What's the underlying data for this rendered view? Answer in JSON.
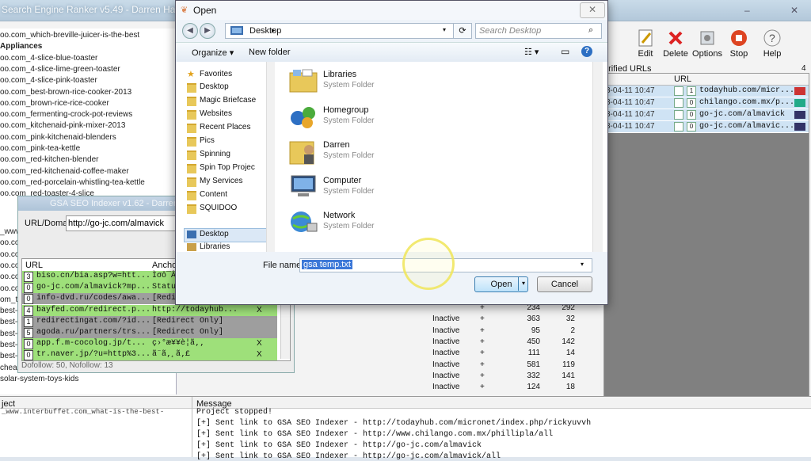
{
  "ser": {
    "title": "Search Engine Ranker v5.49 - Darren Haynes",
    "projects": [
      "oo.com_which-breville-juicer-is-the-best",
      "Appliances",
      "oo.com_4-slice-blue-toaster",
      "oo.com_4-slice-lime-green-toaster",
      "oo.com_4-slice-pink-toaster",
      "oo.com_best-brown-rice-cooker-2013",
      "oo.com_brown-rice-rice-cooker",
      "oo.com_fermenting-crock-pot-reviews",
      "oo.com_kitchenaid-pink-mixer-2013",
      "oo.com_pink-kitchenaid-blenders",
      "oo.com_pink-tea-kettle",
      "oo.com_red-kitchen-blender",
      "oo.com_red-kitchenaid-coffee-maker",
      "oo.com_red-porcelain-whistling-tea-kettle",
      "oo.com_red-toaster-4-slice"
    ],
    "project_list_partial": [
      "_www",
      "oo.com",
      "oo.com",
      "oo.com",
      "oo.com",
      "oo.com",
      "om_to",
      "best-3",
      "best-3",
      "best-c",
      "best-k",
      "best-s",
      "cheap-digital-voice-recorder",
      "solar-system-toys-kids"
    ],
    "toolbar": [
      {
        "label": "Edit",
        "icon": "edit-icon"
      },
      {
        "label": "Delete",
        "icon": "delete-icon"
      },
      {
        "label": "Options",
        "icon": "options-icon"
      },
      {
        "label": "Stop",
        "icon": "stop-icon"
      },
      {
        "label": "Help",
        "icon": "help-icon"
      }
    ],
    "verified_label": "erified URLs",
    "verified_count": "4",
    "verified_url_header": "URL",
    "verified_rows": [
      {
        "date": "3-04-11 10:47",
        "n": "1",
        "url": "todayhub.com/micr...",
        "flag": "uk"
      },
      {
        "date": "3-04-11 10:47",
        "n": "0",
        "url": "chilango.com.mx/p...",
        "flag": "mx"
      },
      {
        "date": "3-04-11 10:47",
        "n": "0",
        "url": "go-jc.com/almavick",
        "flag": "us"
      },
      {
        "date": "3-04-11 10:47",
        "n": "0",
        "url": "go-jc.com/almavic...",
        "flag": "us"
      }
    ],
    "status_rows": [
      {
        "status": "",
        "plus": "+",
        "a": "234",
        "b": "292"
      },
      {
        "status": "Inactive",
        "plus": "+",
        "a": "363",
        "b": "32"
      },
      {
        "status": "Inactive",
        "plus": "+",
        "a": "95",
        "b": "2"
      },
      {
        "status": "Inactive",
        "plus": "+",
        "a": "450",
        "b": "142"
      },
      {
        "status": "Inactive",
        "plus": "+",
        "a": "111",
        "b": "14"
      },
      {
        "status": "Inactive",
        "plus": "+",
        "a": "581",
        "b": "119"
      },
      {
        "status": "Inactive",
        "plus": "+",
        "a": "332",
        "b": "141"
      },
      {
        "status": "Inactive",
        "plus": "+",
        "a": "124",
        "b": "18"
      }
    ]
  },
  "gsa": {
    "title": "GSA SEO Indexer v1.62 - Darren Haynes",
    "url_label": "URL/Domain",
    "url_value": "http://go-jc.com/almavick",
    "col_url": "URL",
    "col_anchor": "Anchor",
    "rows": [
      {
        "n": "3",
        "url": "biso.cn/bia.asp?w=htt...",
        "anchor": "Ìσô¯ÂÌ",
        "x": "",
        "color": "#9ee07a"
      },
      {
        "n": "0",
        "url": "go-jc.com/almavick?mp...",
        "anchor": "Statu",
        "x": "",
        "color": "#9ee07a"
      },
      {
        "n": "0",
        "url": "info-dvd.ru/codes/awa...",
        "anchor": "[Redi",
        "x": "",
        "color": "#9e9e9e"
      },
      {
        "n": "4",
        "url": "bayfed.com/redirect.p...",
        "anchor": "http://todayhub...",
        "x": "X",
        "color": "#9ee07a"
      },
      {
        "n": "1",
        "url": "redirectingat.com/?id...",
        "anchor": "[Redirect Only]",
        "x": "",
        "color": "#9e9e9e"
      },
      {
        "n": "5",
        "url": "agoda.ru/partners/trs...",
        "anchor": "[Redirect Only]",
        "x": "",
        "color": "#9e9e9e"
      },
      {
        "n": "0",
        "url": "app.f.m-cocolog.jp/t...",
        "anchor": "ç›°æ¥¥è¦ã‚‚",
        "x": "X",
        "color": "#9ee07a"
      },
      {
        "n": "0",
        "url": "tr.naver.jp/?u=http%3...",
        "anchor": "ã¨ã‚¸ã‚£",
        "x": "X",
        "color": "#9ee07a"
      }
    ],
    "footer": "Dofollow: 50, Nofollow: 13"
  },
  "log": {
    "col_project": "ject",
    "col_message": "Message",
    "lines": [
      "Project stopped!",
      "[+] Sent link to GSA SEO Indexer - http://todayhub.com/micronet/index.php/rickyuvvh",
      "[+] Sent link to GSA SEO Indexer - http://www.chilango.com.mx/phillipla/all",
      "[+] Sent link to GSA SEO Indexer - http://go-jc.com/almavick",
      "[+] Sent link to GSA SEO Indexer - http://go-jc.com/almavick/all"
    ],
    "left_partial": "_www.interbuffet.com_what-is-the-best-"
  },
  "dialog": {
    "title": "Open",
    "address": "Desktop",
    "search_placeholder": "Search Desktop",
    "organize": "Organize ▾",
    "new_folder": "New folder",
    "nav": [
      {
        "label": "Favorites",
        "icon": "star-icon"
      },
      {
        "label": "Desktop",
        "icon": "folder-icon"
      },
      {
        "label": "Magic Briefcase",
        "icon": "folder-icon"
      },
      {
        "label": "Websites",
        "icon": "folder-icon"
      },
      {
        "label": "Recent Places",
        "icon": "folder-icon"
      },
      {
        "label": "Pics",
        "icon": "folder-icon"
      },
      {
        "label": "Spinning",
        "icon": "folder-icon"
      },
      {
        "label": "Spin Top Projec",
        "icon": "folder-icon"
      },
      {
        "label": "My Services",
        "icon": "folder-icon"
      },
      {
        "label": "Content",
        "icon": "folder-icon"
      },
      {
        "label": "SQUIDOO",
        "icon": "folder-icon"
      },
      {
        "label": "Desktop",
        "icon": "desktop-icon"
      },
      {
        "label": "Libraries",
        "icon": "library-icon"
      }
    ],
    "files": [
      {
        "name": "Libraries",
        "type": "System Folder",
        "icon": "libraries-icon"
      },
      {
        "name": "Homegroup",
        "type": "System Folder",
        "icon": "homegroup-icon"
      },
      {
        "name": "Darren",
        "type": "System Folder",
        "icon": "user-folder-icon"
      },
      {
        "name": "Computer",
        "type": "System Folder",
        "icon": "computer-icon"
      },
      {
        "name": "Network",
        "type": "System Folder",
        "icon": "network-icon"
      }
    ],
    "filename_label": "File name:",
    "filename_value": "gsa temp.txt",
    "open_label": "Open",
    "cancel_label": "Cancel"
  }
}
